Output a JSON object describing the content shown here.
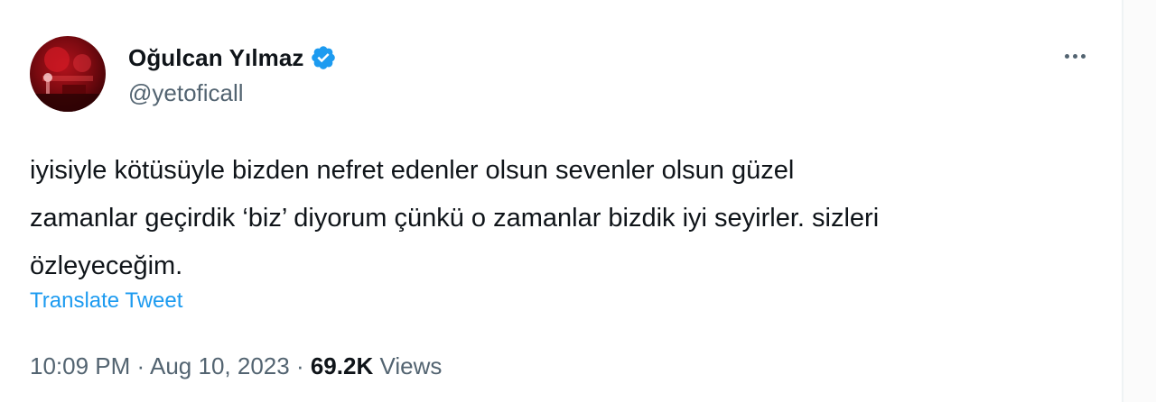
{
  "author": {
    "display_name": "Oğulcan Yılmaz",
    "handle": "@yetoficall",
    "verified": true
  },
  "tweet": {
    "text_lines": [
      "iyisiyle kötüsüyle bizden nefret edenler olsun sevenler olsun güzel",
      "zamanlar geçirdik ‘biz’ diyorum çünkü o zamanlar bizdik iyi seyirler. sizleri",
      "özleyeceğim."
    ],
    "translate_label": "Translate Tweet"
  },
  "meta": {
    "time": "10:09 PM",
    "separator": "·",
    "date": "Aug 10, 2023",
    "views_count": "69.2K",
    "views_label": "Views"
  },
  "icons": {
    "verified": "verified-badge-icon",
    "more": "more-dots-icon"
  },
  "colors": {
    "accent": "#1d9bf0",
    "text_primary": "#0f1419",
    "text_secondary": "#536471"
  }
}
